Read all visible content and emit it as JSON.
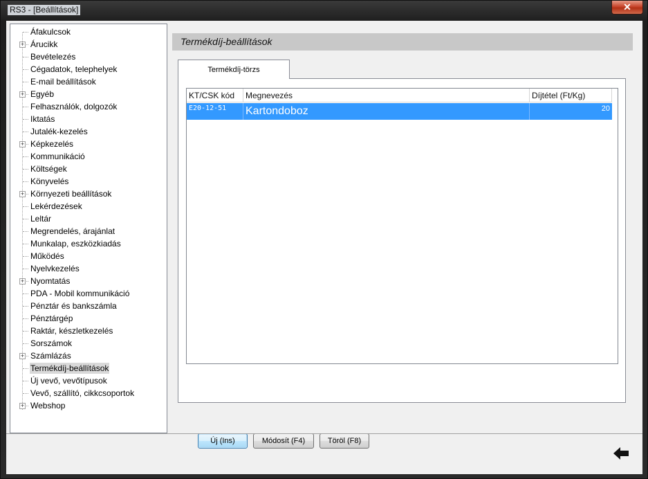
{
  "window": {
    "title": "RS3 - [Beállítások]",
    "close_label": "✕"
  },
  "tree": {
    "items": [
      {
        "label": "Áfakulcsok",
        "expandable": false
      },
      {
        "label": "Árucikk",
        "expandable": true
      },
      {
        "label": "Bevételezés",
        "expandable": false
      },
      {
        "label": "Cégadatok, telephelyek",
        "expandable": false
      },
      {
        "label": "E-mail beállítások",
        "expandable": false
      },
      {
        "label": "Egyéb",
        "expandable": true
      },
      {
        "label": "Felhasználók, dolgozók",
        "expandable": false
      },
      {
        "label": "Iktatás",
        "expandable": false
      },
      {
        "label": "Jutalék-kezelés",
        "expandable": false
      },
      {
        "label": "Képkezelés",
        "expandable": true
      },
      {
        "label": "Kommunikáció",
        "expandable": false
      },
      {
        "label": "Költségek",
        "expandable": false
      },
      {
        "label": "Könyvelés",
        "expandable": false
      },
      {
        "label": "Környezeti beállítások",
        "expandable": true
      },
      {
        "label": "Lekérdezések",
        "expandable": false
      },
      {
        "label": "Leltár",
        "expandable": false
      },
      {
        "label": "Megrendelés, árajánlat",
        "expandable": false
      },
      {
        "label": "Munkalap, eszközkiadás",
        "expandable": false
      },
      {
        "label": "Működés",
        "expandable": false
      },
      {
        "label": "Nyelvkezelés",
        "expandable": false
      },
      {
        "label": "Nyomtatás",
        "expandable": true
      },
      {
        "label": "PDA - Mobil kommunikáció",
        "expandable": false
      },
      {
        "label": "Pénztár és bankszámla",
        "expandable": false
      },
      {
        "label": "Pénztárgép",
        "expandable": false
      },
      {
        "label": "Raktár, készletkezelés",
        "expandable": false
      },
      {
        "label": "Sorszámok",
        "expandable": false
      },
      {
        "label": "Számlázás",
        "expandable": true
      },
      {
        "label": "Termékdíj-beállítások",
        "expandable": false,
        "selected": true
      },
      {
        "label": "Új vevő, vevőtípusok",
        "expandable": false
      },
      {
        "label": "Vevő, szállító, cikkcsoportok",
        "expandable": false
      },
      {
        "label": "Webshop",
        "expandable": true
      }
    ]
  },
  "panel": {
    "header": "Termékdíj-beállítások",
    "tab_label": "Termékdíj-törzs",
    "table": {
      "columns": [
        "KT/CSK kód",
        "Megnevezés",
        "Díjtétel (Ft/Kg)"
      ],
      "rows": [
        {
          "code": "E20-12-51",
          "name": "Kartondoboz",
          "rate": "20"
        }
      ]
    },
    "buttons": {
      "new": "Új (Ins)",
      "modify": "Módosít (F4)",
      "delete": "Töröl (F8)"
    }
  },
  "footer": {
    "back_icon": "back-arrow-icon"
  },
  "colors": {
    "selection": "#3399ff",
    "header_bar": "#c8c8c8",
    "close": "#c8462c"
  }
}
